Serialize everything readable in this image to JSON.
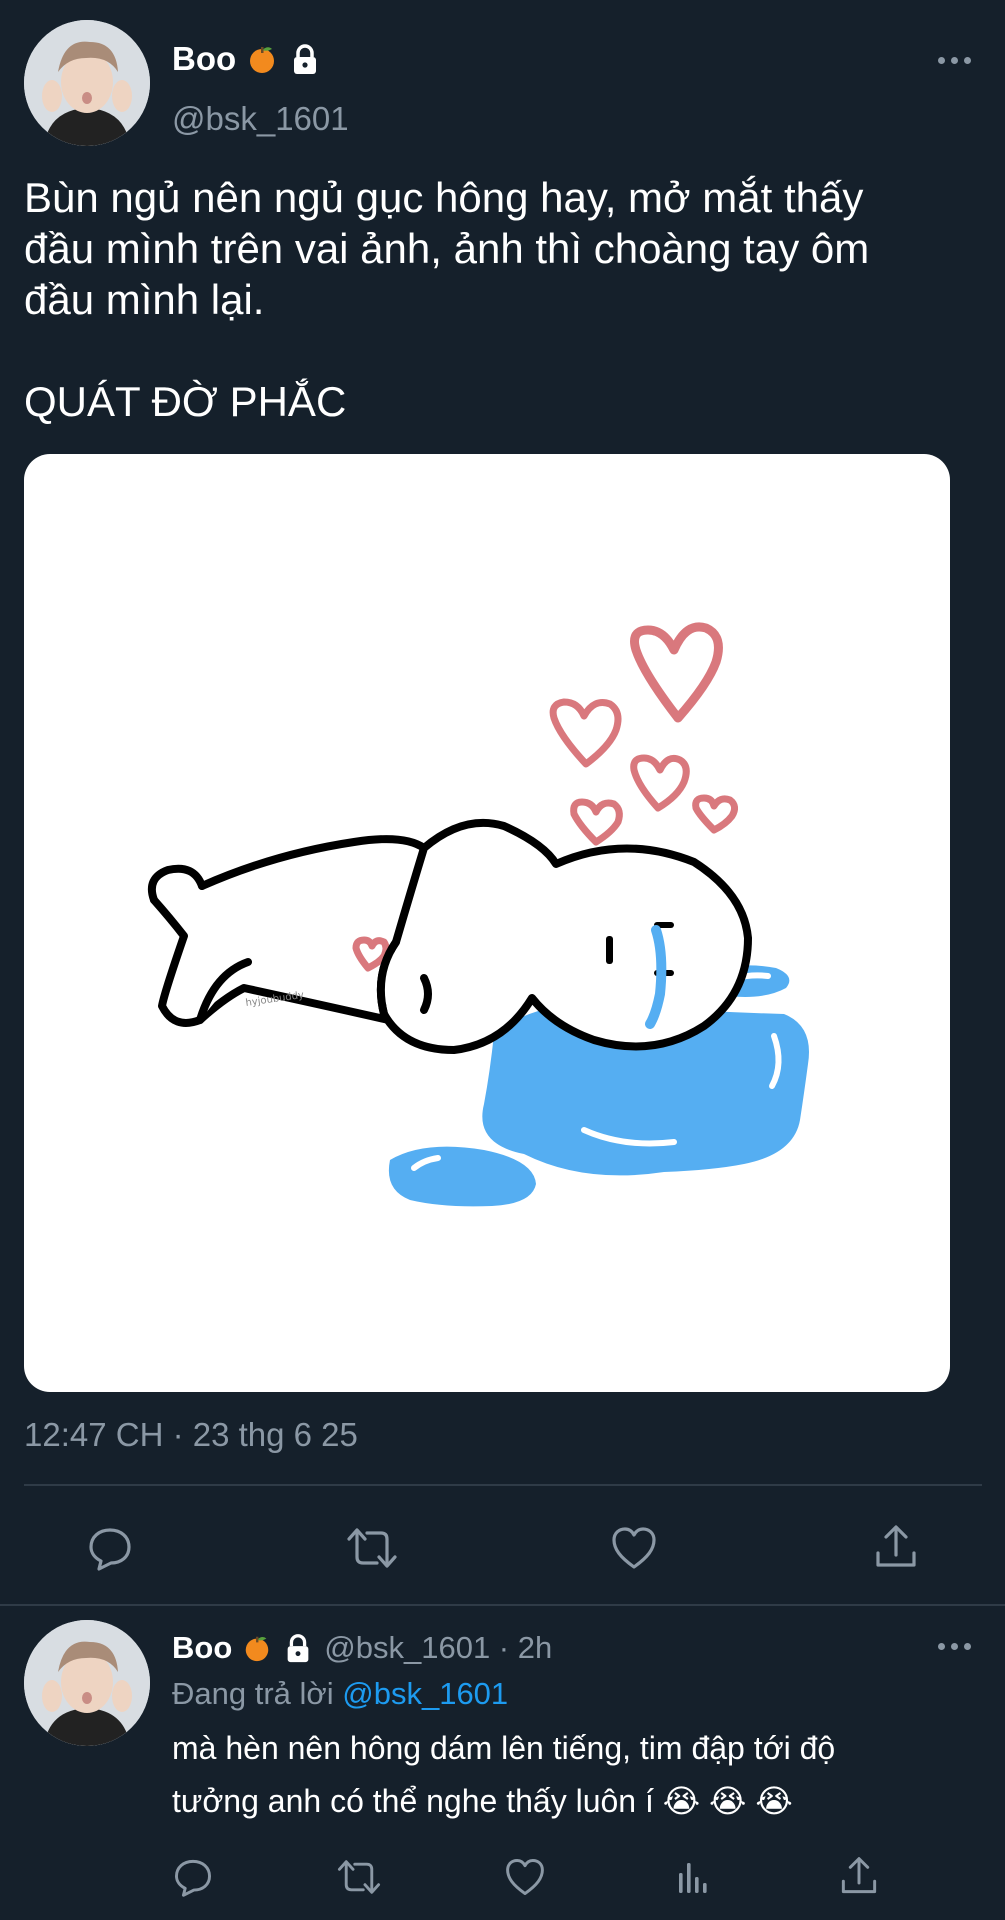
{
  "tweet": {
    "display_name": "Boo",
    "handle": "@bsk_1601",
    "text_line_1": "Bùn ngủ nên ngủ gục hông hay, mở mắt thấy",
    "text_line_2": "đầu mình trên vai ảnh, ảnh thì choàng tay ôm",
    "text_line_3": "đầu mình lại.",
    "text_line_4": "QUÁT ĐỜ PHẮC",
    "timestamp": "12:47 CH · 23 thg 6 25",
    "icons": {
      "badge": "orange-emoji",
      "lock": "lock-icon",
      "more": "more-icon",
      "reply": "reply-icon",
      "retweet": "retweet-icon",
      "like": "like-icon",
      "share": "share-icon"
    }
  },
  "reply": {
    "display_name": "Boo",
    "handle_time": "@bsk_1601 · 2h",
    "replying_prefix": "Đang trả lời",
    "replying_mention": "@bsk_1601",
    "text_line_1": "mà hèn nên hông dám lên tiếng, tim đập tới độ",
    "text_line_2": "tưởng anh có thể nghe thấy luôn í 😭 😭 😭",
    "icons": {
      "reply": "reply-icon",
      "retweet": "retweet-icon",
      "like": "like-icon",
      "analytics": "analytics-icon",
      "share": "share-icon"
    }
  },
  "colors": {
    "background": "#15202b",
    "secondary_text": "#8b98a5",
    "link": "#1d9bf0",
    "divider": "#2f3b47",
    "puddle": "#55aef2",
    "heart_pink": "#d9787d"
  }
}
